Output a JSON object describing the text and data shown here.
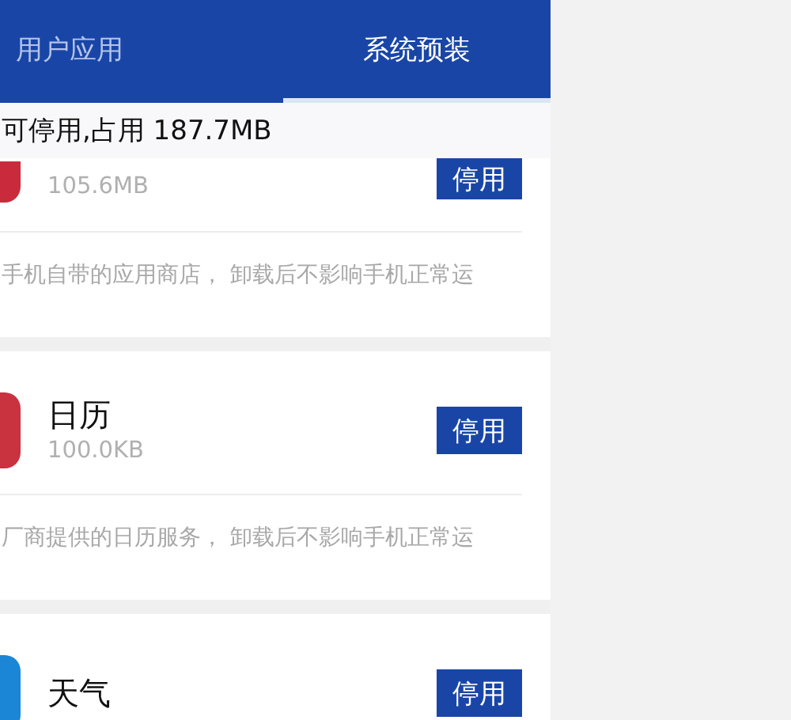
{
  "tabs": [
    {
      "label": "用户应用",
      "selected": false
    },
    {
      "label": "系统预装",
      "selected": true
    }
  ],
  "banner": "可停用,占用 187.7MB",
  "apps": [
    {
      "size": "105.6MB",
      "button": "停用",
      "description": "手机自带的应用商店， 卸载后不影响手机正常运",
      "color": "#c92b3c"
    },
    {
      "name": "日历",
      "size": "100.0KB",
      "button": "停用",
      "description": "厂商提供的日历服务， 卸载后不影响手机正常运",
      "color": "#c9323f"
    },
    {
      "name": "天气",
      "button": "停用",
      "color": "#1b86d6"
    }
  ]
}
